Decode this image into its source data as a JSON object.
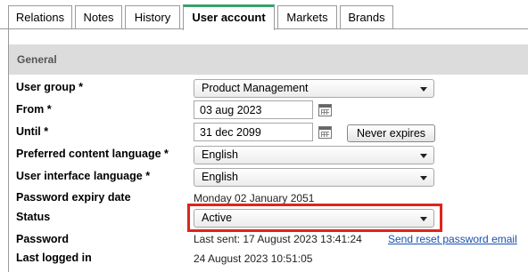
{
  "tabs": [
    {
      "label": "Relations"
    },
    {
      "label": "Notes"
    },
    {
      "label": "History"
    },
    {
      "label": "User account",
      "active": true
    },
    {
      "label": "Markets"
    },
    {
      "label": "Brands"
    }
  ],
  "section": {
    "title": "General"
  },
  "fields": {
    "user_group": {
      "label": "User group *",
      "value": "Product Management"
    },
    "from": {
      "label": "From *",
      "value": "03 aug 2023"
    },
    "until": {
      "label": "Until *",
      "value": "31 dec 2099"
    },
    "never_expires_button": "Never expires",
    "preferred_content_language": {
      "label": "Preferred content language *",
      "value": "English"
    },
    "user_interface_language": {
      "label": "User interface language *",
      "value": "English"
    },
    "password_expiry_date": {
      "label": "Password expiry date",
      "value": "Monday 02 January 2051"
    },
    "status": {
      "label": "Status",
      "value": "Active"
    },
    "password": {
      "label": "Password",
      "value": "Last sent: 17 August 2023 13:41:24",
      "link": "Send reset password email"
    },
    "last_logged_in": {
      "label": "Last logged in",
      "value": "24 August 2023 10:51:05"
    }
  },
  "colors": {
    "active_tab_accent": "#3aa06a",
    "section_bar": "#dcdcdc",
    "highlight_border": "#e0241b",
    "link": "#1a4fb0"
  },
  "icons": {
    "calendar": "calendar-icon",
    "dropdown": "chevron-down-icon"
  }
}
